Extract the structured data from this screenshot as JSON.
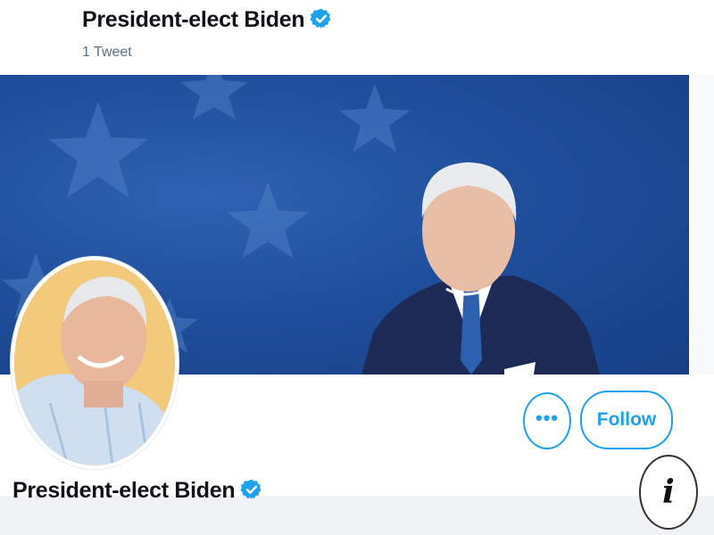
{
  "header": {
    "display_name": "President-elect Biden",
    "tweet_count": "1 Tweet"
  },
  "profile": {
    "display_name": "President-elect Biden",
    "verified_badge_icon": "verified-check-icon"
  },
  "actions": {
    "more_label": "•••",
    "follow_label": "Follow"
  },
  "overlay": {
    "info_label": "i"
  },
  "colors": {
    "accent": "#1da1f2",
    "banner_blue": "#1f4f9c",
    "text_primary": "#0f1419",
    "text_secondary": "#5b7083"
  }
}
